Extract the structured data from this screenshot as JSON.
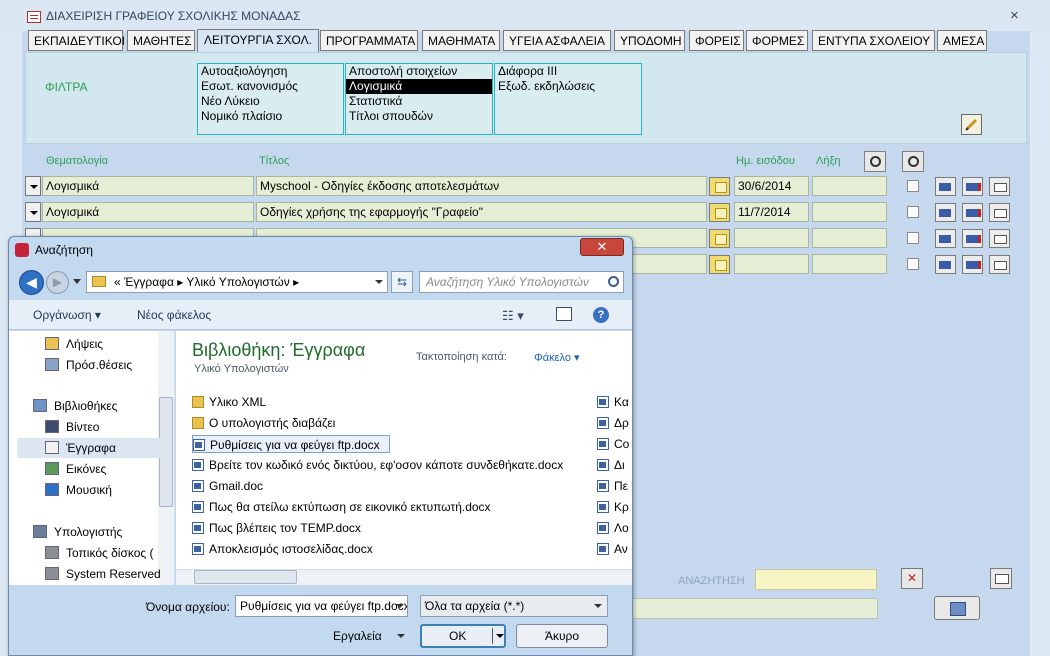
{
  "window": {
    "title": "ΔΙΑΧΕΙΡΙΣΗ  ΓΡΑΦΕΙΟΥ ΣΧΟΛΙΚΗΣ ΜΟΝΑΔΑΣ",
    "close": "×"
  },
  "tabs": [
    "ΕΚΠΑΙΔΕΥΤΙΚΟΙ",
    "ΜΑΘΗΤΕΣ",
    "ΛΕΙΤΟΥΡΓΙΑ ΣΧΟΛ.",
    "ΠΡΟΓΡΑΜΜΑΤΑ",
    "ΜΑΘΗΜΑΤΑ",
    "ΥΓΕΙΑ ΑΣΦΑΛΕΙΑ",
    "ΥΠΟΔΟΜΗ",
    "ΦΟΡΕΙΣ",
    "ΦΟΡΜΕΣ",
    "ΕΝΤΥΠΑ ΣΧΟΛΕΙΟΥ",
    "ΑΜΕΣΑ"
  ],
  "active_tab": "ΛΕΙΤΟΥΡΓΙΑ ΣΧΟΛ.",
  "filters": {
    "label": "ΦΙΛΤΡΑ",
    "list1": [
      "Αυτοαξιολόγηση",
      "Εσωτ. κανονισμός",
      "Νέο Λύκειο",
      "Νομικό πλαίσιο"
    ],
    "list2": [
      "Αποστολή στοιχείων",
      "Λογισμικά",
      "Στατιστικά",
      "Τίτλοι σπουδών"
    ],
    "list2_selected": "Λογισμικά",
    "list3": [
      "Διάφορα ΙΙΙ",
      "Εξωδ. εκδηλώσεις"
    ]
  },
  "columns": {
    "topic": "Θεματολογία",
    "title": "Τίτλος",
    "entry_date": "Ημ. εισόδου",
    "expiry": "Λήξη"
  },
  "rows": [
    {
      "topic": "Λογισμικά",
      "title": "Myschool - Οδηγίες έκδοσης αποτελεσμάτων",
      "date": "30/6/2014",
      "expiry": ""
    },
    {
      "topic": "Λογισμικά",
      "title": "Οδηγίες χρήσης της εφαρμογής \"Γραφείο\"",
      "date": "11/7/2014",
      "expiry": ""
    },
    {
      "topic": "",
      "title": "",
      "date": "",
      "expiry": ""
    },
    {
      "topic": "",
      "title": "",
      "date": "",
      "expiry": ""
    }
  ],
  "search": {
    "label": "ΑΝΑΖΗΤΗΣΗ",
    "value": ""
  },
  "dialog": {
    "title": "Αναζήτηση",
    "close": "✕",
    "address": "«  Έγγραφα  ▸  Υλικό Υπολογιστών  ▸",
    "search_placeholder": "Αναζήτηση Υλικό Υπολογιστών",
    "organize": "Οργάνωση ▾",
    "new_folder": "Νέος φάκελος",
    "nav": [
      {
        "label": "Λήψεις",
        "icon": "downloads-folder-icon"
      },
      {
        "label": "Πρόσ.θέσεις",
        "icon": "recent-places-icon"
      },
      {
        "label": "Βιβλιοθήκες",
        "icon": "libraries-icon"
      },
      {
        "label": "Βίντεο",
        "icon": "videos-icon"
      },
      {
        "label": "Έγγραφα",
        "icon": "documents-icon"
      },
      {
        "label": "Εικόνες",
        "icon": "pictures-icon"
      },
      {
        "label": "Μουσική",
        "icon": "music-icon"
      },
      {
        "label": "Υπολογιστής",
        "icon": "computer-icon"
      },
      {
        "label": "Τοπικός δίσκος (",
        "icon": "local-disk-icon"
      },
      {
        "label": "System Reserved",
        "icon": "drive-icon"
      }
    ],
    "nav_selected": "Έγγραφα",
    "library_title": "Βιβλιοθήκη: Έγγραφα",
    "library_subtitle": "Υλικό Υπολογιστών",
    "sort_label": "Τακτοποίηση κατά:",
    "sort_value": "Φάκελο ▾",
    "files": [
      {
        "name": "Υλικο XML",
        "type": "folder"
      },
      {
        "name": "Ο υπολογιστής διαβάζει",
        "type": "folder"
      },
      {
        "name": "Ρυθμίσεις για να φεύγει ftp.docx",
        "type": "doc"
      },
      {
        "name": "Βρείτε τον κωδικό ενός δικτύου, εφ'οσον κάποτε συνδεθήκατε.docx",
        "type": "doc"
      },
      {
        "name": "Gmail.doc",
        "type": "doc"
      },
      {
        "name": "Πως θα στείλω  εκτύπωση σε εικονικό εκτυπωτή.docx",
        "type": "doc"
      },
      {
        "name": "Πως βλέπεις τον TEMP.docx",
        "type": "doc"
      },
      {
        "name": "Αποκλεισμός ιστοσελίδας.docx",
        "type": "doc"
      }
    ],
    "selected_file": "Ρυθμίσεις για να φεύγει ftp.docx",
    "files_col2": [
      "Κα",
      "Δρ",
      "Co",
      "Δι",
      "Πε",
      "Κρ",
      "Λο",
      "Αν"
    ],
    "filename_label": "Όνομα αρχείου:",
    "filename_value": "Ρυθμίσεις για να φεύγει ftp.docx",
    "filetype": "Όλα τα αρχεία (*.*)",
    "tools": "Εργαλεία",
    "ok": "OK",
    "cancel": "Άκυρο"
  }
}
